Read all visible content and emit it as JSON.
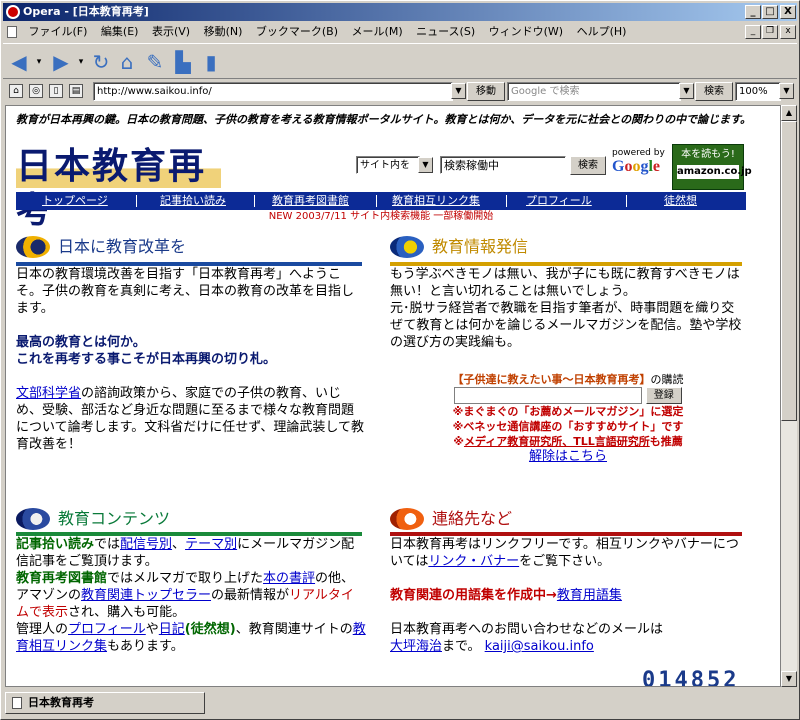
{
  "window": {
    "title": "Opera - [日本教育再考]",
    "min": "_",
    "max": "□",
    "close": "X"
  },
  "menu": [
    "ファイル(F)",
    "編集(E)",
    "表示(V)",
    "移動(N)",
    "ブックマーク(B)",
    "メール(M)",
    "ニュース(S)",
    "ウィンドウ(W)",
    "ヘルプ(H)"
  ],
  "address": {
    "url": "http://www.saikou.info/",
    "go": "移動",
    "search_placeholder": "Google で検索",
    "search_btn": "検索",
    "zoom": "100%"
  },
  "page": {
    "intro": "教育が日本再興の鍵。日本の教育問題、子供の教育を考える教育情報ポータルサイト。教育とは何か、データを元に社会との関わりの中で論じます。",
    "logo": "日本教育再考",
    "site_search": {
      "scope": "サイト内を",
      "value": "検索稼働中",
      "button": "検索"
    },
    "powered": {
      "line1": "powered by",
      "google": "Google"
    },
    "amazon": {
      "text": "本を読もう!",
      "logo": "amazon.co.jp"
    },
    "nav": [
      "トップページ",
      "記事拾い読み",
      "教育再考図書館",
      "教育相互リンク集",
      "プロフィール",
      "徒然想"
    ],
    "news": "NEW 2003/7/11 サイト内検索機能 一部稼働開始",
    "s1": {
      "title": "日本に教育改革を",
      "p1": "日本の教育環境改善を目指す「日本教育再考」へようこそ。子供の教育を真剣に考え、日本の教育の改革を目指します。",
      "b1": "最高の教育とは何か。",
      "b2": "これを再考する事こそが日本再興の切り札。",
      "link": "文部科学省",
      "p2": "の諮詢政策から、家庭での子供の教育、いじめ、受験、部活など身近な問題に至るまで様々な教育問題について論考します。文科省だけに任せず、理論武装して教育改善を！"
    },
    "s2": {
      "title": "教育情報発信",
      "p1": "もう学ぶべきモノは無い、我が子にも既に教育すべきモノは無い！と言い切れることは無いでしょう。",
      "p2": "元･脱サラ経営者で教職を目指す筆者が、時事問題を織り交ぜて教育とは何かを論じるメールマガジンを配信。塾や学校の選び方の実践編も。",
      "mag": "【子供達に教えたい事～日本教育再考】",
      "mag_suffix": "の購読",
      "login": "登録",
      "n1": "※まぐまぐの「お薦めメールマガジン」に選定",
      "n2": "※ベネッセ通信講座の「おすすめサイト」です",
      "n3a": "※",
      "n3link": "メディア教育研究所、TLL言語研究所",
      "n3b": "も推薦",
      "cancel": "解除はこちら"
    },
    "s3": {
      "title": "教育コンテンツ",
      "a_bold": "記事拾い読み",
      "a1": "では",
      "l1": "配信号別",
      "a2": "、",
      "l2": "テーマ別",
      "a3": "にメールマガジン配信記事をご覧頂けます。",
      "b_bold": "教育再考図書館",
      "b1": "ではメルマガで取り上げた",
      "l3": "本の書評",
      "b2": "の他、アマゾンの",
      "l4": "教育関連トップセラー",
      "b3": "の最新情報が",
      "b_red": "リアルタイムで表示",
      "b4": "され、購入も可能。",
      "c1": "管理人の",
      "l5": "プロフィール",
      "c2": "や",
      "l6": "日記",
      "c_bold": "(徒然想)",
      "c3": "、教育関連サイトの",
      "l7": "教育相互リンク集",
      "c4": "もあります。"
    },
    "s4": {
      "title": "連絡先など",
      "p1a": "日本教育再考はリンクフリーです。相互リンクやバナーについては",
      "l1": "リンク・バナー",
      "p1b": "をご覧下さい。",
      "red": "教育関連の用語集を作成中→",
      "l2": "教育用語集",
      "p2": "日本教育再考へのお問い合わせなどのメールは",
      "l3": "大坪海治",
      "p3": "まで。",
      "l4": "kaiji@saikou.info"
    },
    "counter": "014852"
  },
  "status": {
    "tab": "日本教育再考"
  },
  "colors": {
    "nav": "#0c2a96",
    "rule_blue": "#1a4aa0",
    "rule_gold": "#d4a000",
    "rule_green": "#1a8a3a",
    "rule_red": "#b01010"
  }
}
